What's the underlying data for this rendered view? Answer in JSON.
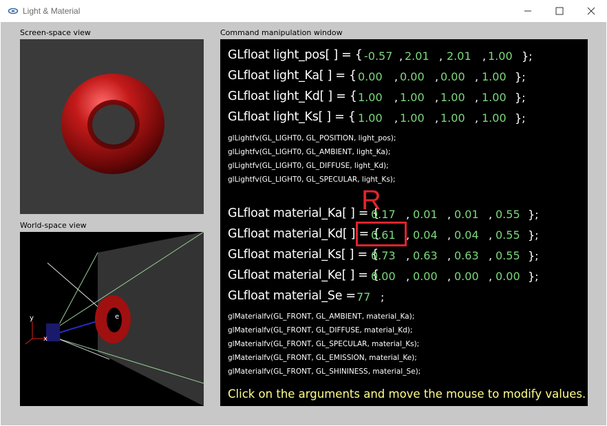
{
  "window": {
    "title": "Light & Material"
  },
  "screen_view": {
    "label": "Screen-space view"
  },
  "world_view": {
    "label": "World-space view",
    "axis_y": "y",
    "axis_x": "x",
    "point_label": "e"
  },
  "command_window": {
    "label": "Command manipulation window",
    "light_pos": {
      "decl": "GLfloat light_pos[ ] = {",
      "values": [
        "-0.57",
        "2.01",
        "2.01",
        "1.00"
      ],
      "end": "};"
    },
    "light_Ka": {
      "decl": "GLfloat light_Ka[ ] = {",
      "values": [
        "0.00",
        "0.00",
        "0.00",
        "1.00"
      ],
      "end": "};"
    },
    "light_Kd": {
      "decl": "GLfloat light_Kd[ ] = {",
      "values": [
        "1.00",
        "1.00",
        "1.00",
        "1.00"
      ],
      "end": "};"
    },
    "light_Ks": {
      "decl": "GLfloat light_Ks[ ] = {",
      "values": [
        "1.00",
        "1.00",
        "1.00",
        "1.00"
      ],
      "end": "};"
    },
    "light_calls": [
      "glLightfv(GL_LIGHT0, GL_POSITION, light_pos);",
      "glLightfv(GL_LIGHT0, GL_AMBIENT, light_Ka);",
      "glLightfv(GL_LIGHT0, GL_DIFFUSE, light_Kd);",
      "glLightfv(GL_LIGHT0, GL_SPECULAR, light_Ks);"
    ],
    "material_Ka": {
      "decl": "GLfloat material_Ka[ ] = {",
      "values": [
        "0.17",
        "0.01",
        "0.01",
        "0.55"
      ],
      "end": "};"
    },
    "material_Kd": {
      "decl": "GLfloat material_Kd[ ] = {",
      "values": [
        "0.61",
        "0.04",
        "0.04",
        "0.55"
      ],
      "end": "};"
    },
    "material_Ks": {
      "decl": "GLfloat material_Ks[ ] = {",
      "values": [
        "0.73",
        "0.63",
        "0.63",
        "0.55"
      ],
      "end": "};"
    },
    "material_Ke": {
      "decl": "GLfloat material_Ke[ ] = {",
      "values": [
        "0.00",
        "0.00",
        "0.00",
        "0.00"
      ],
      "end": "};"
    },
    "material_Se": {
      "decl": "GLfloat material_Se =",
      "value": "77",
      "end": ";"
    },
    "material_calls": [
      "glMaterialfv(GL_FRONT, GL_AMBIENT, material_Ka);",
      "glMaterialfv(GL_FRONT, GL_DIFFUSE, material_Kd);",
      "glMaterialfv(GL_FRONT, GL_SPECULAR, material_Ks);",
      "glMaterialfv(GL_FRONT, GL_EMISSION, material_Ke);",
      "glMaterialfv(GL_FRONT, GL_SHININESS, material_Se);"
    ],
    "hint": "Click on the arguments and move the mouse to modify values."
  },
  "annotation": {
    "label": "R",
    "color": "#e0242d"
  },
  "colors": {
    "value_green": "#7cd87c",
    "hint_yellow": "#ffff8c",
    "torus_red": "#b81818"
  }
}
